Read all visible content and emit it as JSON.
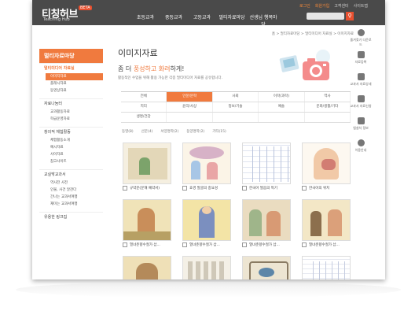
{
  "header": {
    "logo": "티칭허브",
    "logo_sub": "Teaching Hub",
    "beta": "BETA",
    "util": [
      "로그인",
      "회원가입",
      "고객센터",
      "사이트맵"
    ],
    "gnb": [
      "초등교과",
      "중등교과",
      "고등교과",
      "멀티자료마당",
      "선생님 행복마당"
    ],
    "search_placeholder": ""
  },
  "breadcrumb": "홈 > 멀티자료마당 > 멀티미디어 자료실 > 이미지자료",
  "sidebar": {
    "title": "멀티자료마당",
    "section1": "멀티미디어 자료실",
    "items1": [
      "이미지자료",
      "플래시자료",
      "동영상자료"
    ],
    "section2": "자료나눔터",
    "items2": [
      "교과활동자료",
      "학급운영자료"
    ],
    "section3": "창의적 체험활동",
    "items3": [
      "체험활동소개",
      "예시자료",
      "사이자료",
      "참고사이트"
    ],
    "section4": "교실밖교과서",
    "items4": [
      "역사전 사전",
      "인물, 사건 알찬다",
      "간나는 교과서여행",
      "재미는 교과서여행"
    ],
    "section5": "유용한 링크집"
  },
  "main": {
    "title": "이미지자료",
    "hero_prefix": "좀 더 ",
    "hero_highlight": "풍성하고 화려",
    "hero_suffix": "하게!",
    "hero_desc": "활동적인 수업을 위해 활용 가능한 각종 멀티미디어 자료를 공유합니다.",
    "subject_rows": [
      [
        "전체",
        "인문/문학",
        "사회",
        "이학(과학)",
        "역사"
      ],
      [
        "지리",
        "윤리/사상",
        "정보/기술",
        "예술",
        "문화/생활/기타"
      ],
      [
        "생명/건강",
        "",
        "",
        "",
        ""
      ]
    ],
    "filters": [
      "동영(8)",
      "선문(4)",
      "서양명학(2)",
      "동양명학(2)",
      "기타(15)"
    ],
    "thumbnails": [
      "규약문(문해 예약서)",
      "효경 발굴의 중요성",
      "한국어 발음의 특기",
      "한국어의 위치",
      "열녀춘향수절가 삽...",
      "열녀춘향수절가 삽...",
      "열녀춘향수절가 삽...",
      "열녀춘향수절가 삽...",
      "",
      "",
      "",
      ""
    ]
  },
  "quick_menu": [
    "즐겨찾기 다운로드",
    "자료등록",
    "교과서 자료상세",
    "교과서 자료신청",
    "앱설치 정보",
    "이용안내"
  ],
  "colors": {
    "accent": "#f07a3e",
    "header": "#4a4a4a"
  }
}
